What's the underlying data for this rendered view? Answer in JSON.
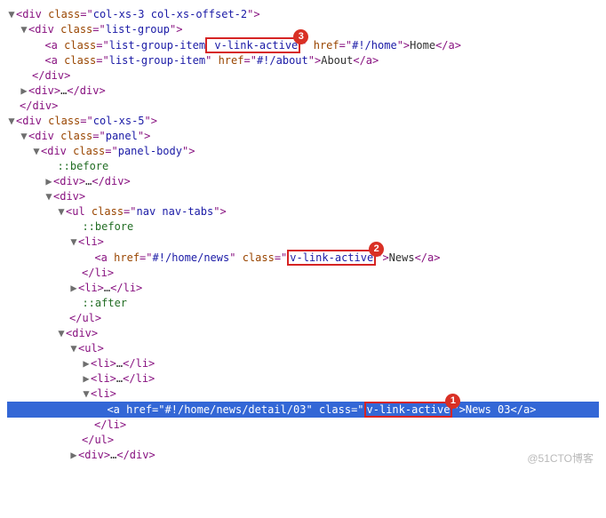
{
  "col": [
    "…",
    "col-xs-3 col-xs-offset-2",
    "list-group",
    "list-group-item",
    "v-link-active",
    "#!/home",
    "Home",
    "#!/about",
    "About",
    "col-xs-5",
    "panel",
    "panel-body",
    "::before",
    "nav nav-tabs",
    "#!/home/news",
    "News",
    "::after",
    "#!/home/news/detail/03",
    "News 03"
  ],
  "sym": {
    "div": "div",
    "a": "a",
    "ul": "ul",
    "li": "li",
    "cls": "class",
    "href": "href",
    "opn": "▼",
    "cls2": "▶"
  },
  "badge": [
    "1",
    "2",
    "3"
  ],
  "watermark": "@51CTO博客"
}
